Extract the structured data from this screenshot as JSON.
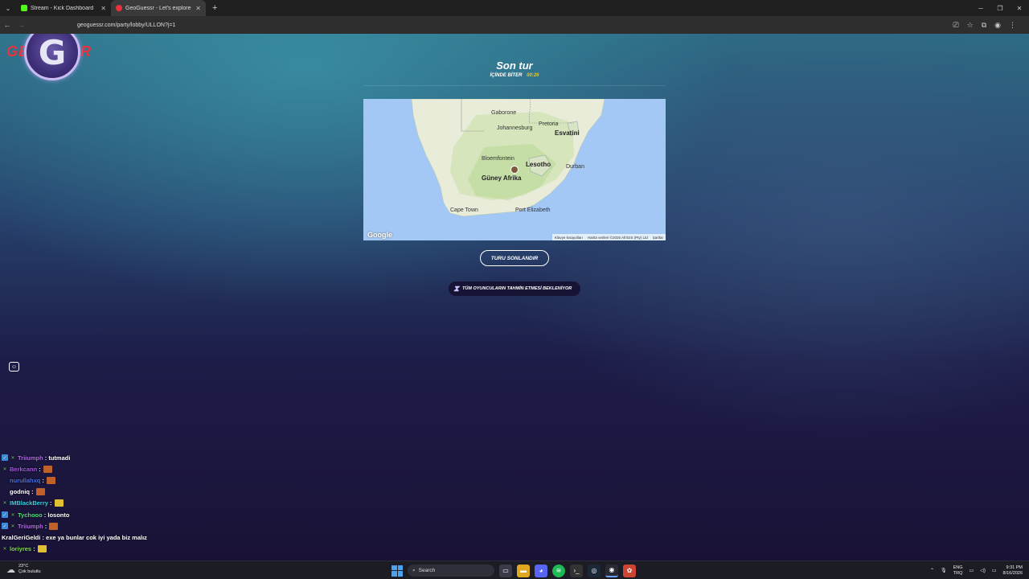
{
  "browser": {
    "tabs": [
      {
        "label": "Stream - Kick Dashboard",
        "favicon_color": "#53fc18",
        "active": false
      },
      {
        "label": "GeoGuessr - Let's explore the ...",
        "favicon_color": "#e8323c",
        "active": true
      }
    ],
    "new_tab_label": "+",
    "url": "geoguessr.com/party/lobby/ULLON?j=1"
  },
  "game": {
    "logo_text_left": "GE",
    "logo_letter": "G",
    "logo_text_right": "R",
    "round_title": "Son tur",
    "round_sub_label": "İÇİNDE BİTER",
    "round_timer": "00:26",
    "end_round_button": "TURU SONLANDIR",
    "waiting_text": "TÜM OYUNCULARIN TAHMİN ETMESİ BEKLENİYOR"
  },
  "map": {
    "labels": {
      "gaborone": "Gaborone",
      "johannesburg": "Johannesburg",
      "pretoria": "Pretoria",
      "esvatini": "Esvatini",
      "bloemfontein": "Bloemfontein",
      "lesotho": "Lesotho",
      "durban": "Durban",
      "guney_afrika": "Güney Afrika",
      "cape_town": "Cape Town",
      "port_elizabeth": "Port Elizabeth"
    },
    "google_logo": "Google",
    "attribution": [
      "Klavye kısayolları",
      "Harita verileri ©2026 AfriGIS (Pty) Ltd",
      "Şartlar"
    ]
  },
  "chat": [
    {
      "user": "Triiumph",
      "color": "#b06be0",
      "badge": "sub",
      "msg": "tutmadi",
      "emote": false
    },
    {
      "user": "Berkcann",
      "color": "#a259d9",
      "badge": "x",
      "msg": "",
      "emote": true
    },
    {
      "user": "nurullahxq",
      "color": "#4a6fe0",
      "badge": "dot",
      "msg": "",
      "emote": true
    },
    {
      "user": "godniq",
      "color": "#ffffff",
      "badge": "dot",
      "msg": "",
      "emote": true
    },
    {
      "user": "IMBlackBerry",
      "color": "#3ad0e0",
      "badge": "x",
      "msg": "",
      "emote": true,
      "emote_color": "#e0c030"
    },
    {
      "user": "Tychooo",
      "color": "#4be07a",
      "badge": "sub",
      "msg": "losonto",
      "emote": false
    },
    {
      "user": "Triiumph",
      "color": "#b06be0",
      "badge": "sub",
      "msg": "",
      "emote": true
    },
    {
      "user": "KralGeriGeldi",
      "color": "#ffffff",
      "badge": "none",
      "msg": "exe ya bunlar cok iyi yada biz malız",
      "emote": false
    },
    {
      "user": "loriyres",
      "color": "#7de04b",
      "badge": "x",
      "msg": "",
      "emote": true,
      "emote_color": "#e0c030"
    }
  ],
  "taskbar": {
    "weather_temp": "23°C",
    "weather_desc": "Çok bulutlu",
    "search_label": "Search",
    "lang_top": "ENG",
    "lang_bottom": "TRQ",
    "time": "9:31 PM",
    "date": "8/16/2026"
  }
}
